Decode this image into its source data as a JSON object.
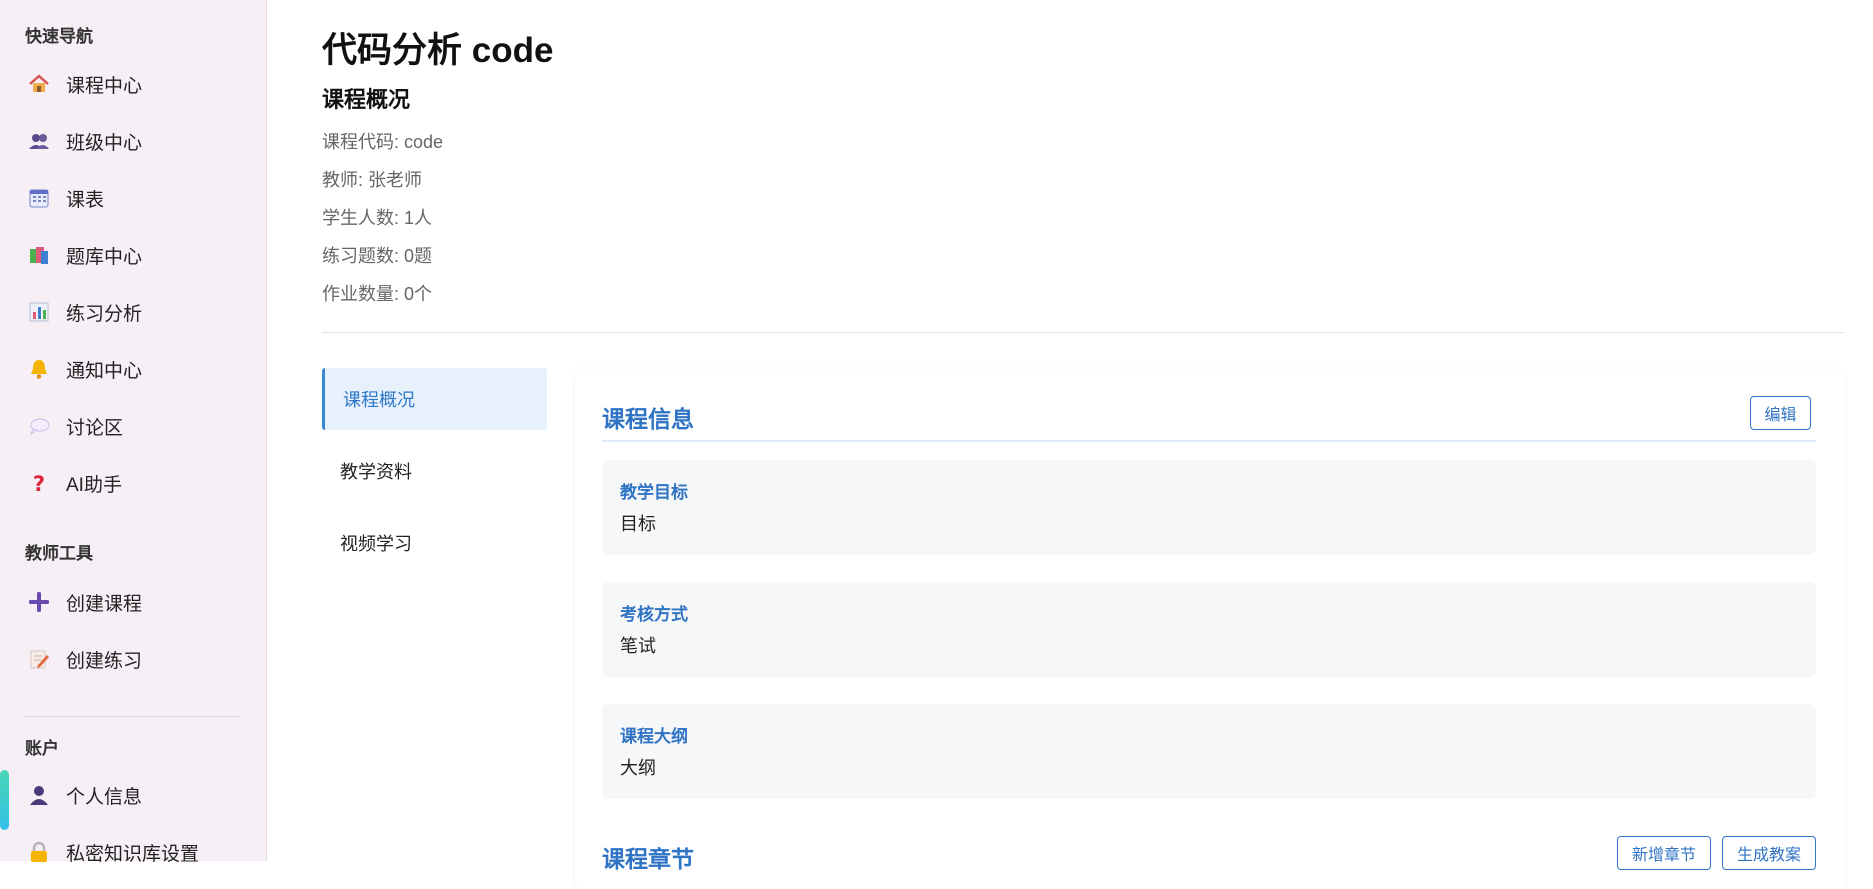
{
  "sidebar": {
    "quick_nav_title": "快速导航",
    "quick_nav": [
      {
        "label": "课程中心",
        "icon": "house-icon"
      },
      {
        "label": "班级中心",
        "icon": "users-icon"
      },
      {
        "label": "课表",
        "icon": "calendar-icon"
      },
      {
        "label": "题库中心",
        "icon": "books-icon"
      },
      {
        "label": "练习分析",
        "icon": "bar-chart-icon"
      },
      {
        "label": "通知中心",
        "icon": "bell-icon"
      },
      {
        "label": "讨论区",
        "icon": "speech-bubble-icon"
      },
      {
        "label": "AI助手",
        "icon": "question-mark-icon"
      }
    ],
    "teacher_tools_title": "教师工具",
    "teacher_tools": [
      {
        "label": "创建课程",
        "icon": "plus-icon"
      },
      {
        "label": "创建练习",
        "icon": "memo-icon"
      }
    ],
    "account_title": "账户",
    "account": [
      {
        "label": "个人信息",
        "icon": "person-icon"
      },
      {
        "label": "私密知识库设置",
        "icon": "lock-icon"
      }
    ]
  },
  "header": {
    "title": "代码分析 code",
    "subtitle": "课程概况",
    "meta": [
      "课程代码: code",
      "教师: 张老师",
      "学生人数: 1人",
      "练习题数: 0题",
      "作业数量: 0个"
    ]
  },
  "tabs": [
    {
      "label": "课程概况",
      "active": true
    },
    {
      "label": "教学资料",
      "active": false
    },
    {
      "label": "视频学习",
      "active": false
    }
  ],
  "course_info": {
    "title": "课程信息",
    "edit_label": "编辑",
    "items": [
      {
        "label": "教学目标",
        "value": "目标"
      },
      {
        "label": "考核方式",
        "value": "笔试"
      },
      {
        "label": "课程大纲",
        "value": "大纲"
      }
    ]
  },
  "chapters": {
    "title": "课程章节",
    "add_label": "新增章节",
    "generate_label": "生成教案"
  },
  "colors": {
    "accent": "#2f73c4",
    "sidebar_bg": "#f6eff6",
    "active_tab_bg": "#e6f1fc",
    "active_indicator": "#47d6b6"
  }
}
